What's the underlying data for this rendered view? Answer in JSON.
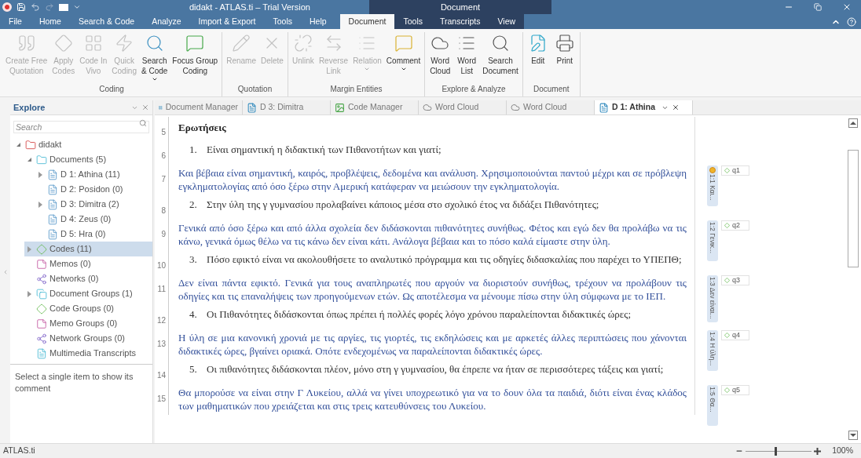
{
  "window": {
    "title": "didakt - ATLAS.ti – Trial Version",
    "context_group": "Document"
  },
  "ribbon_tabs": [
    {
      "label": "File",
      "selected": false,
      "contextual": false
    },
    {
      "label": "Home",
      "selected": false,
      "contextual": false
    },
    {
      "label": "Search & Code",
      "selected": false,
      "contextual": false
    },
    {
      "label": "Analyze",
      "selected": false,
      "contextual": false
    },
    {
      "label": "Import & Export",
      "selected": false,
      "contextual": false
    },
    {
      "label": "Tools",
      "selected": false,
      "contextual": false
    },
    {
      "label": "Help",
      "selected": false,
      "contextual": false
    },
    {
      "label": "Document",
      "selected": true,
      "contextual": true
    },
    {
      "label": "Tools",
      "selected": false,
      "contextual": true
    },
    {
      "label": "Transcripts",
      "selected": false,
      "contextual": true
    },
    {
      "label": "View",
      "selected": false,
      "contextual": true
    }
  ],
  "ribbon_groups": [
    {
      "label": "Coding",
      "buttons": [
        {
          "kind": "quote",
          "lines": [
            "Create Free",
            "Quotation"
          ],
          "disabled": true,
          "dropdown": false
        },
        {
          "kind": "diamond",
          "lines": [
            "Apply",
            "Codes"
          ],
          "disabled": true,
          "dropdown": false
        },
        {
          "kind": "invivo",
          "lines": [
            "Code In",
            "Vivo"
          ],
          "disabled": true,
          "dropdown": false
        },
        {
          "kind": "quick",
          "lines": [
            "Quick",
            "Coding"
          ],
          "disabled": true,
          "dropdown": false
        },
        {
          "kind": "searchcode",
          "lines": [
            "Search",
            "& Code"
          ],
          "disabled": false,
          "dropdown": true
        },
        {
          "kind": "focus",
          "lines": [
            "Focus Group",
            "Coding"
          ],
          "disabled": false,
          "dropdown": false
        }
      ]
    },
    {
      "label": "Quotation",
      "buttons": [
        {
          "kind": "rename",
          "lines": [
            "Rename"
          ],
          "disabled": true,
          "dropdown": false
        },
        {
          "kind": "delete",
          "lines": [
            "Delete"
          ],
          "disabled": true,
          "dropdown": false
        }
      ]
    },
    {
      "label": "Margin Entities",
      "buttons": [
        {
          "kind": "unlink",
          "lines": [
            "Unlink"
          ],
          "disabled": true,
          "dropdown": false
        },
        {
          "kind": "reverse",
          "lines": [
            "Reverse",
            "Link"
          ],
          "disabled": true,
          "dropdown": false
        },
        {
          "kind": "relation",
          "lines": [
            "Relation"
          ],
          "disabled": true,
          "dropdown": true
        },
        {
          "kind": "comment",
          "lines": [
            "Comment"
          ],
          "disabled": false,
          "dropdown": true
        }
      ]
    },
    {
      "label": "Explore & Analyze",
      "buttons": [
        {
          "kind": "cloud",
          "lines": [
            "Word",
            "Cloud"
          ],
          "disabled": false,
          "dropdown": false
        },
        {
          "kind": "list",
          "lines": [
            "Word",
            "List"
          ],
          "disabled": false,
          "dropdown": false
        },
        {
          "kind": "search",
          "lines": [
            "Search",
            "Document"
          ],
          "disabled": false,
          "dropdown": false
        }
      ]
    },
    {
      "label": "Document",
      "buttons": [
        {
          "kind": "edit",
          "lines": [
            "Edit"
          ],
          "disabled": false,
          "dropdown": false
        },
        {
          "kind": "print",
          "lines": [
            "Print"
          ],
          "disabled": false,
          "dropdown": false
        }
      ]
    }
  ],
  "explore": {
    "title": "Explore",
    "search": {
      "placeholder": "Search"
    },
    "tree": [
      {
        "kind": "project",
        "label": "didakt",
        "expanded": true,
        "children": [
          {
            "kind": "documents",
            "label": "Documents (5)",
            "expanded": true,
            "selected": false,
            "children": [
              {
                "kind": "document",
                "label": "D 1: Athina (11)",
                "expanded": false,
                "selected": false
              },
              {
                "kind": "document",
                "label": "D 2: Posidon (0)",
                "selected": false
              },
              {
                "kind": "document",
                "label": "D 3: Dimitra (2)",
                "expanded": false,
                "selected": false
              },
              {
                "kind": "document",
                "label": "D 4: Zeus (0)",
                "selected": false
              },
              {
                "kind": "document",
                "label": "D 5: Hra (0)",
                "selected": false
              }
            ]
          },
          {
            "kind": "codes",
            "label": "Codes (11)",
            "expanded": false,
            "selected": true
          },
          {
            "kind": "memos",
            "label": "Memos (0)",
            "selected": false
          },
          {
            "kind": "networks",
            "label": "Networks (0)",
            "selected": false
          },
          {
            "kind": "docgroups",
            "label": "Document Groups (1)",
            "expanded": false,
            "selected": false
          },
          {
            "kind": "codegroups",
            "label": "Code Groups (0)",
            "selected": false
          },
          {
            "kind": "memogroups",
            "label": "Memo Groups (0)",
            "selected": false
          },
          {
            "kind": "netgroups",
            "label": "Network Groups (0)",
            "selected": false
          },
          {
            "kind": "transcripts",
            "label": "Multimedia Transcripts",
            "selected": false
          }
        ]
      }
    ],
    "comment": "Select a single item to show its comment"
  },
  "doc_tabs": [
    {
      "kind": "manager",
      "label": "Document Manager",
      "selected": false
    },
    {
      "kind": "document",
      "label": "D 3: Dimitra",
      "selected": false
    },
    {
      "kind": "codemanager",
      "label": "Code Manager",
      "selected": false
    },
    {
      "kind": "cloud",
      "label": "Word Cloud",
      "selected": false
    },
    {
      "kind": "cloud",
      "label": "Word Cloud",
      "selected": false
    },
    {
      "kind": "document",
      "label": "D 1: Athina",
      "selected": true
    }
  ],
  "document": {
    "rows": [
      {
        "line": "5",
        "kind": "heading",
        "text": "Ερωτήσεις"
      },
      {
        "line": "6",
        "kind": "question",
        "number": "1.",
        "text": "Είναι σημαντική η διδακτική των Πιθανοτήτων και γιατί;"
      },
      {
        "line": "7",
        "kind": "answer",
        "text": "Και βέβαια είναι σημαντική, καιρός, προβλέψεις, δεδομένα και ανάλυση. Χρησιμοποιούνται παντού μέχρι και σε πρόβλεψη εγκληματολογίας από όσο ξέρω στην Αμερική κατάφεραν να μειώσουν την εγκληματολογία.",
        "quotation": {
          "label": "1:1 Και...",
          "code": "q1",
          "commented": true
        }
      },
      {
        "line": "8",
        "kind": "question",
        "number": "2.",
        "text": "Στην ύλη της γ γυμνασίου προλαβαίνει κάποιος μέσα στο σχολικό έτος να διδάξει Πιθανότητες;"
      },
      {
        "line": "9",
        "kind": "answer",
        "text": "Γενικά από όσο ξέρω και από άλλα σχολεία δεν διδάσκονται πιθανότητες συνήθως. Φέτος και εγώ δεν θα προλάβω να τις κάνω, γενικά όμως θέλω να τις κάνω δεν είναι κάτι. Ανάλογα βέβαια και το πόσο καλά είμαστε στην ύλη.",
        "quotation": {
          "label": "1:2 Γενικ...",
          "code": "q2",
          "commented": false
        }
      },
      {
        "line": "10",
        "kind": "question",
        "number": "3.",
        "text": "Πόσο εφικτό είναι να ακολουθήσετε το αναλυτικό πρόγραμμα και τις οδηγίες διδασκαλίας που παρέχει το ΥΠΕΠΘ;"
      },
      {
        "line": "11",
        "kind": "answer",
        "text": "Δεν είναι πάντα εφικτό. Γενικά για τους αναπληρωτές που αργούν να διοριστούν συνήθως, τρέχουν να προλάβουν τις οδηγίες και τις επαναλήψεις των προηγούμενων ετών. Ως αποτέλεσμα να μένουμε πίσω στην ύλη σύμφωνα με το ΙΕΠ.",
        "quotation": {
          "label": "1:3 Δεν είναι...",
          "code": "q3",
          "commented": false
        }
      },
      {
        "line": "12",
        "kind": "question",
        "number": "4.",
        "text": "Οι Πιθανότητες διδάσκονται όπως πρέπει ή πολλές φορές λόγο χρόνου παραλείπονται διδακτικές ώρες;"
      },
      {
        "line": "13",
        "kind": "answer",
        "text": "Η ύλη σε μια κανονική χρονιά με τις αργίες, τις γιορτές, τις εκδηλώσεις και με αρκετές άλλες περιπτώσεις που χάνονται διδακτικές ώρες, βγαίνει οριακά. Οπότε ενδεχομένως να παραλείπονται διδακτικές ώρες.",
        "quotation": {
          "label": "1:4 Η ύλη...",
          "code": "q4",
          "commented": false
        }
      },
      {
        "line": "14",
        "kind": "question",
        "number": "5.",
        "text": "Οι πιθανότητες διδάσκονται πλέον, μόνο στη γ γυμνασίου, θα έπρεπε να ήταν σε περισσότερες τάξεις και γιατί;"
      },
      {
        "line": "15",
        "kind": "answer",
        "text": "Θα μπορούσε να είναι στην Γ Λυκείου, αλλά να γίνει υποχρεωτικό για να το δουν όλα τα παιδιά, διότι είναι ένας κλάδος των μαθηματικών που χρειάζεται και στις τρεις κατευθύνσεις του Λυκείου.",
        "quotation": {
          "label": "1:5 Θα...",
          "code": "q5",
          "commented": false
        }
      }
    ]
  },
  "status_bar": {
    "text": "ATLAS.ti",
    "zoom": {
      "level": 0.45,
      "reading": "100%"
    }
  }
}
